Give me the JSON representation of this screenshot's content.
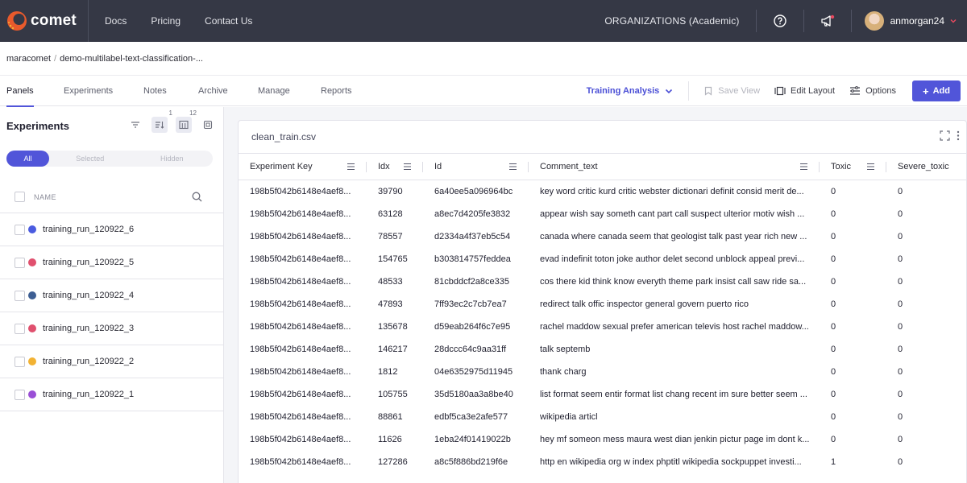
{
  "app": {
    "brand": "comet",
    "nav": [
      "Docs",
      "Pricing",
      "Contact Us"
    ],
    "organization": "ORGANIZATIONS (Academic)",
    "username": "anmorgan24"
  },
  "breadcrumb": [
    "maracomet",
    "demo-multilabel-text-classification-..."
  ],
  "tabs": [
    "Panels",
    "Experiments",
    "Notes",
    "Archive",
    "Manage",
    "Reports"
  ],
  "toolbar": {
    "view_select": "Training Analysis",
    "save_view": "Save View",
    "edit_layout": "Edit Layout",
    "options": "Options",
    "add": "Add"
  },
  "sidebar": {
    "title": "Experiments",
    "sort_badge": "1",
    "columns_badge": "12",
    "filters": [
      "All",
      "Selected",
      "Hidden"
    ],
    "name_header": "NAME",
    "experiments": [
      {
        "name": "training_run_120922_6",
        "color": "#4a5be0"
      },
      {
        "name": "training_run_120922_5",
        "color": "#e0506e"
      },
      {
        "name": "training_run_120922_4",
        "color": "#3d5e93"
      },
      {
        "name": "training_run_120922_3",
        "color": "#e0506e"
      },
      {
        "name": "training_run_120922_2",
        "color": "#f2b233"
      },
      {
        "name": "training_run_120922_1",
        "color": "#9a4fd6"
      }
    ]
  },
  "panel": {
    "title": "clean_train.csv",
    "columns": [
      "Experiment Key",
      "Idx",
      "Id",
      "Comment_text",
      "Toxic",
      "Severe_toxic"
    ],
    "rows": [
      [
        "198b5f042b6148e4aef8...",
        "39790",
        "6a40ee5a096964bc",
        "key word critic kurd critic webster dictionari definit consid merit de...",
        "0",
        "0"
      ],
      [
        "198b5f042b6148e4aef8...",
        "63128",
        "a8ec7d4205fe3832",
        "appear wish say someth cant part call suspect ulterior motiv wish ...",
        "0",
        "0"
      ],
      [
        "198b5f042b6148e4aef8...",
        "78557",
        "d2334a4f37eb5c54",
        "canada where canada seem that geologist talk past year rich new ...",
        "0",
        "0"
      ],
      [
        "198b5f042b6148e4aef8...",
        "154765",
        "b303814757feddea",
        "evad indefinit toton joke author delet second unblock appeal previ...",
        "0",
        "0"
      ],
      [
        "198b5f042b6148e4aef8...",
        "48533",
        "81cbddcf2a8ce335",
        "cos there kid think know everyth theme park insist call saw ride sa...",
        "0",
        "0"
      ],
      [
        "198b5f042b6148e4aef8...",
        "47893",
        "7ff93ec2c7cb7ea7",
        "redirect talk offic inspector general govern puerto rico",
        "0",
        "0"
      ],
      [
        "198b5f042b6148e4aef8...",
        "135678",
        "d59eab264f6c7e95",
        "rachel maddow sexual prefer american televis host rachel maddow...",
        "0",
        "0"
      ],
      [
        "198b5f042b6148e4aef8...",
        "146217",
        "28dccc64c9aa31ff",
        "talk septemb",
        "0",
        "0"
      ],
      [
        "198b5f042b6148e4aef8...",
        "1812",
        "04e6352975d11945",
        "thank charg",
        "0",
        "0"
      ],
      [
        "198b5f042b6148e4aef8...",
        "105755",
        "35d5180aa3a8be40",
        "list format seem entir format list chang recent im sure better seem ...",
        "0",
        "0"
      ],
      [
        "198b5f042b6148e4aef8...",
        "88861",
        "edbf5ca3e2afe577",
        "wikipedia articl",
        "0",
        "0"
      ],
      [
        "198b5f042b6148e4aef8...",
        "11626",
        "1eba24f01419022b",
        "hey mf someon mess maura west dian jenkin pictur page im dont k...",
        "0",
        "0"
      ],
      [
        "198b5f042b6148e4aef8...",
        "127286",
        "a8c5f886bd219f6e",
        "http en wikipedia org w index phptitl wikipedia sockpuppet investi...",
        "1",
        "0"
      ]
    ]
  }
}
